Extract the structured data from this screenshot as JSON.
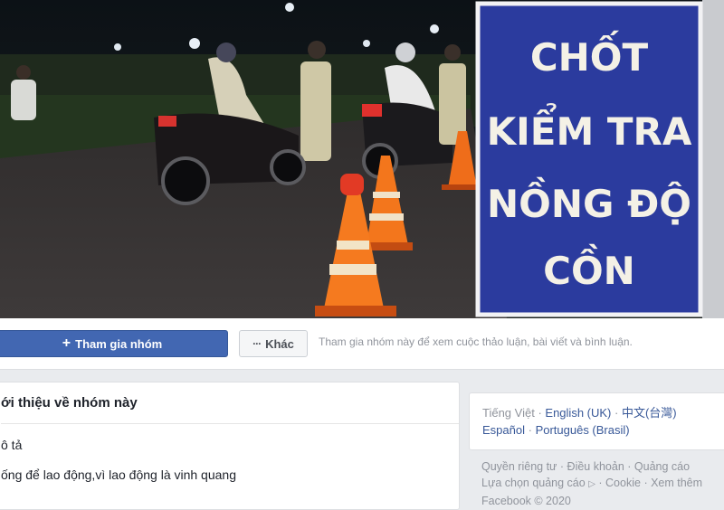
{
  "cover": {
    "sign_lines": [
      "CHỐT",
      "KIỂM TRA",
      "NỒNG ĐỘ",
      "CỒN"
    ]
  },
  "group_bar": {
    "join_label": "Tham gia nhóm",
    "more_label": "Khác",
    "join_hint": "Tham gia nhóm này để xem cuộc thảo luận, bài viết và bình luận."
  },
  "about": {
    "title": "ới thiệu về nhóm này",
    "description_label": "ô tả",
    "description": "ống để lao động,vì lao động là vinh quang"
  },
  "languages": {
    "current": "Tiếng Việt",
    "items": [
      "English (UK)",
      "中文(台灣)",
      "Español",
      "Português (Brasil)"
    ]
  },
  "footer": {
    "links": [
      "Quyền riêng tư",
      "Điều khoản",
      "Quảng cáo",
      "Lựa chọn quảng cáo",
      "Cookie",
      "Xem thêm"
    ],
    "copyright": "Facebook © 2020"
  },
  "colors": {
    "primary": "#4267b2",
    "link": "#385898",
    "muted": "#90949c",
    "sign_blue": "#2b3b9e",
    "page_bg": "#e9ebee"
  }
}
